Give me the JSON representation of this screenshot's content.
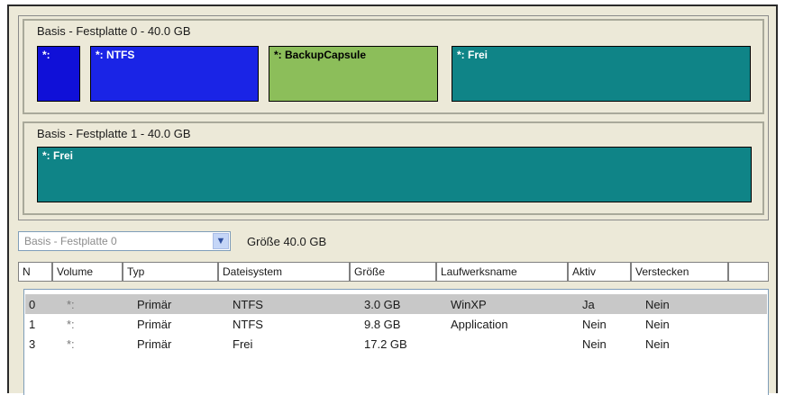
{
  "disks": [
    {
      "label": "Basis - Festplatte 0 - 40.0 GB",
      "partitions": [
        {
          "label": "*:",
          "color": "#1010d8"
        },
        {
          "label": "*: NTFS",
          "color": "#1a24e6"
        },
        {
          "label": "*: BackupCapsule",
          "color": "#8cbe5a"
        },
        {
          "label": "*: Frei",
          "color": "#0f8487"
        }
      ]
    },
    {
      "label": "Basis - Festplatte 1 - 40.0 GB",
      "partitions": [
        {
          "label": "*: Frei",
          "color": "#0f8487"
        }
      ]
    }
  ],
  "toolbar": {
    "disk_select_value": "Basis - Festplatte 0",
    "size_text": "Größe 40.0 GB"
  },
  "table": {
    "headers": [
      "N",
      "Volume",
      "Typ",
      "Dateisystem",
      "Größe",
      "Laufwerksname",
      "Aktiv",
      "Verstecken"
    ],
    "rows": [
      {
        "n": "0",
        "volume": "*:",
        "typ": "Primär",
        "fs": "NTFS",
        "size": "3.0 GB",
        "name": "WinXP",
        "active": "Ja",
        "hidden": "Nein",
        "selected": true
      },
      {
        "n": "1",
        "volume": "*:",
        "typ": "Primär",
        "fs": "NTFS",
        "size": "9.8 GB",
        "name": "Application",
        "active": "Nein",
        "hidden": "Nein",
        "selected": false
      },
      {
        "n": "3",
        "volume": "*:",
        "typ": "Primär",
        "fs": "Frei",
        "size": "17.2 GB",
        "name": "",
        "active": "Nein",
        "hidden": "Nein",
        "selected": false
      }
    ]
  }
}
